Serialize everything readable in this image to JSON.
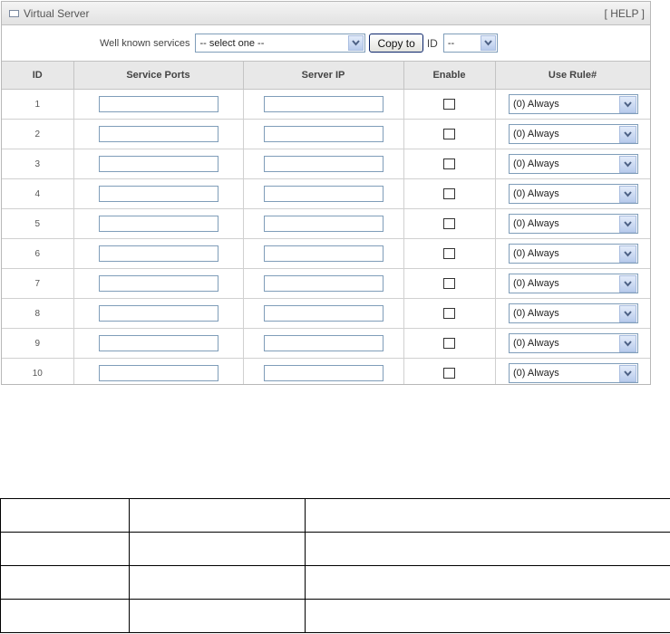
{
  "panel": {
    "title": "Virtual Server",
    "help_label": "[ HELP ]"
  },
  "toolbar": {
    "services_label": "Well known services",
    "services_value": "-- select one --",
    "copy_button": "Copy to",
    "id_label": "ID",
    "id_value": "--"
  },
  "table": {
    "headers": [
      "ID",
      "Service Ports",
      "Server IP",
      "Enable",
      "Use Rule#"
    ],
    "rows": [
      {
        "id": "1",
        "rule": "(0) Always"
      },
      {
        "id": "2",
        "rule": "(0) Always"
      },
      {
        "id": "3",
        "rule": "(0) Always"
      },
      {
        "id": "4",
        "rule": "(0) Always"
      },
      {
        "id": "5",
        "rule": "(0) Always"
      },
      {
        "id": "6",
        "rule": "(0) Always"
      },
      {
        "id": "7",
        "rule": "(0) Always"
      },
      {
        "id": "8",
        "rule": "(0) Always"
      },
      {
        "id": "9",
        "rule": "(0) Always"
      },
      {
        "id": "10",
        "rule": "(0) Always"
      }
    ]
  },
  "colors": {
    "header_bg": "#e8e8e8",
    "input_border": "#7f9db9",
    "dropdown_arrow": "#4d6185"
  },
  "icons": {
    "title": "panel-square-icon",
    "dropdown": "chevron-down-icon"
  }
}
